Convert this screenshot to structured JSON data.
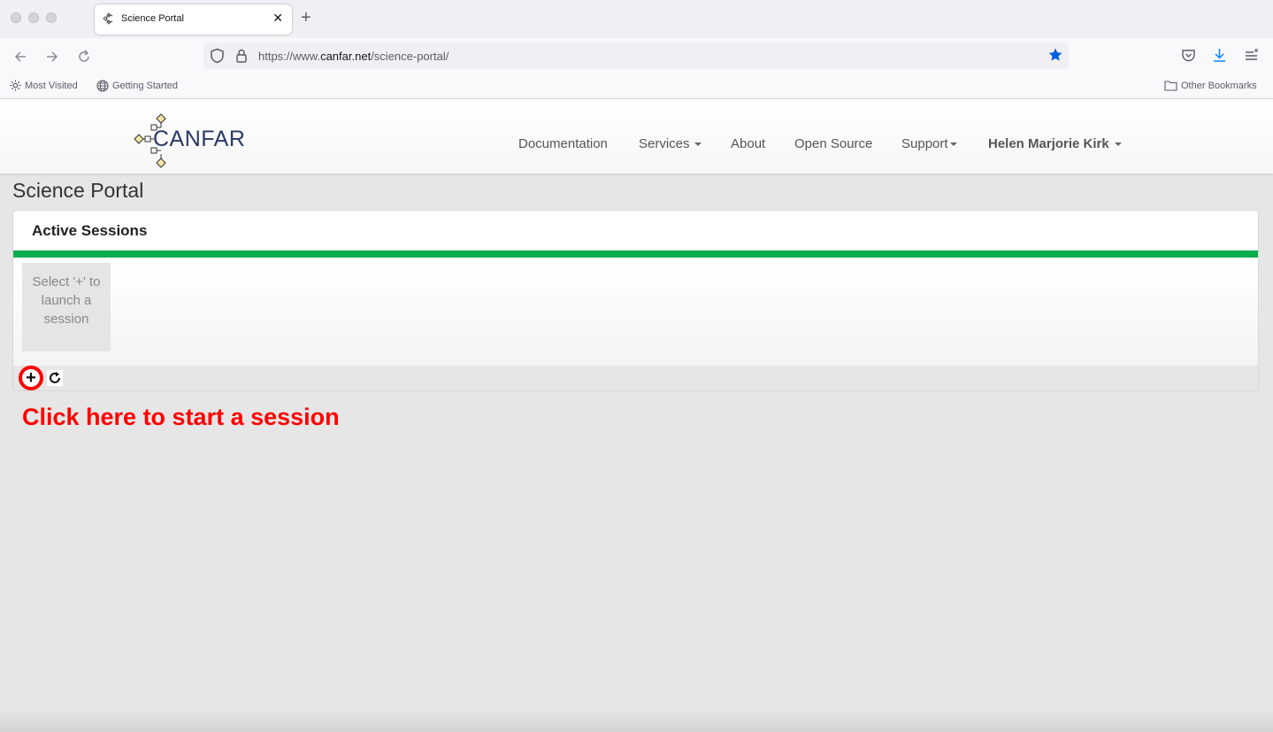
{
  "browser": {
    "tab_title": "Science Portal",
    "url_prefix": "https://www.",
    "url_host": "canfar.net",
    "url_path": "/science-portal/",
    "bookmarks": [
      "Most Visited",
      "Getting Started"
    ],
    "other_bookmarks": "Other Bookmarks",
    "star_color": "#0060df"
  },
  "header": {
    "logo_text": "CANFAR",
    "menu": [
      "Documentation",
      "Services",
      "About",
      "Open Source",
      "Support"
    ],
    "user": "Helen Marjorie Kirk"
  },
  "page": {
    "title": "Science Portal",
    "panel_title": "Active Sessions",
    "placeholder": "Select '+' to launch a session",
    "add_label": "+",
    "annotation": "Click here to start a session",
    "accent_color": "#0dad4e",
    "annotation_color": "#ff0000"
  }
}
